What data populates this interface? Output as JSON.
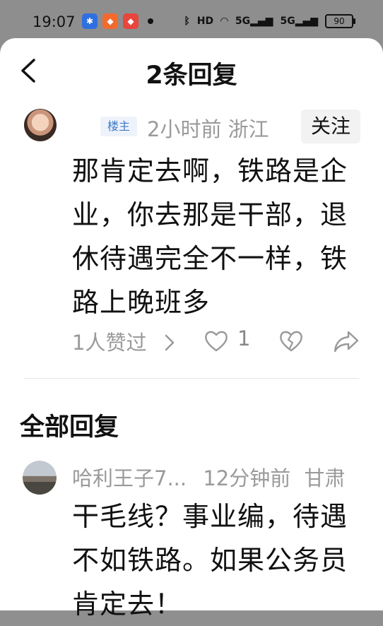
{
  "status_bar": {
    "time": "19:07",
    "battery": "90",
    "network_labels": [
      "HD",
      "5G",
      "5G"
    ],
    "icons": [
      "baidu-icon",
      "app-icon-orange",
      "app-icon-red",
      "bluetooth-icon",
      "hd-icon",
      "wifi-icon",
      "signal-icon",
      "signal-icon",
      "battery-icon"
    ]
  },
  "header": {
    "title": "2条回复"
  },
  "main_comment": {
    "badge": "楼主",
    "meta": "2小时前 浙江",
    "follow_label": "关注",
    "text": "那肯定去啊，铁路是企业，你去那是干部，退休待遇完全不一样，铁路上晚班多",
    "likes_text": "1人赞过",
    "like_count": "1"
  },
  "replies_section": {
    "title": "全部回复"
  },
  "replies": [
    {
      "author": "哈利王子7...",
      "time": "12分钟前",
      "location": "甘肃",
      "text": "干毛线？事业编，待遇不如铁路。如果公务员肯定去！"
    }
  ],
  "colors": {
    "background_dim": "#8f8f8f",
    "badge_blue": "#3f79c8",
    "muted_text": "#9a9a9a"
  }
}
